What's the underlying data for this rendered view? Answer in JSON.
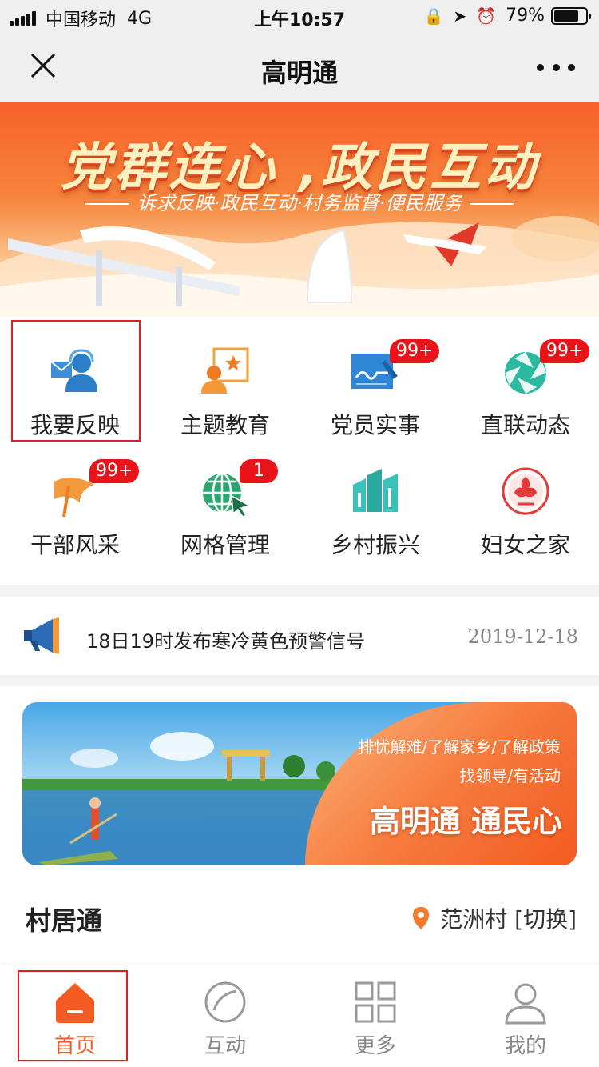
{
  "status_bar": {
    "carrier": "中国移动",
    "network": "4G",
    "time": "上午10:57",
    "battery": "79%",
    "battery_level": 0.79
  },
  "nav": {
    "title": "高明通",
    "close_icon": "close-icon",
    "more_icon": "more-icon"
  },
  "banner": {
    "title": "党群连心 ,政民互动",
    "subtitle": "诉求反映·政民互动·村务监督·便民服务"
  },
  "grid": [
    {
      "label": "我要反映",
      "icon": "feedback-person-icon",
      "badge": ""
    },
    {
      "label": "主题教育",
      "icon": "person-star-icon",
      "badge": ""
    },
    {
      "label": "党员实事",
      "icon": "signature-icon",
      "badge": "99+"
    },
    {
      "label": "直联动态",
      "icon": "aperture-icon",
      "badge": "99+"
    },
    {
      "label": "干部风采",
      "icon": "flag-icon",
      "badge": "99+"
    },
    {
      "label": "网格管理",
      "icon": "globe-cursor-icon",
      "badge": "1"
    },
    {
      "label": "乡村振兴",
      "icon": "buildings-icon",
      "badge": ""
    },
    {
      "label": "妇女之家",
      "icon": "women-emblem-icon",
      "badge": ""
    }
  ],
  "notice": {
    "icon": "megaphone-icon",
    "text": "18日19时发布寒冷黄色预警信号",
    "date": "2019-12-18"
  },
  "promo": {
    "line1": "排忧解难/了解家乡/了解政策",
    "line2": "找领导/有活动",
    "slogan": "高明通 通民心"
  },
  "section": {
    "title": "村居通",
    "location": "范洲村 [切换]",
    "location_icon": "location-pin-icon"
  },
  "tabs": [
    {
      "label": "首页",
      "icon": "home-icon",
      "active": true
    },
    {
      "label": "互动",
      "icon": "circle-icon",
      "active": false
    },
    {
      "label": "更多",
      "icon": "grid-icon",
      "active": false
    },
    {
      "label": "我的",
      "icon": "user-icon",
      "active": false
    }
  ],
  "colors": {
    "accent": "#f35b22",
    "badge": "#e8141a",
    "highlight_box": "#e02020"
  }
}
